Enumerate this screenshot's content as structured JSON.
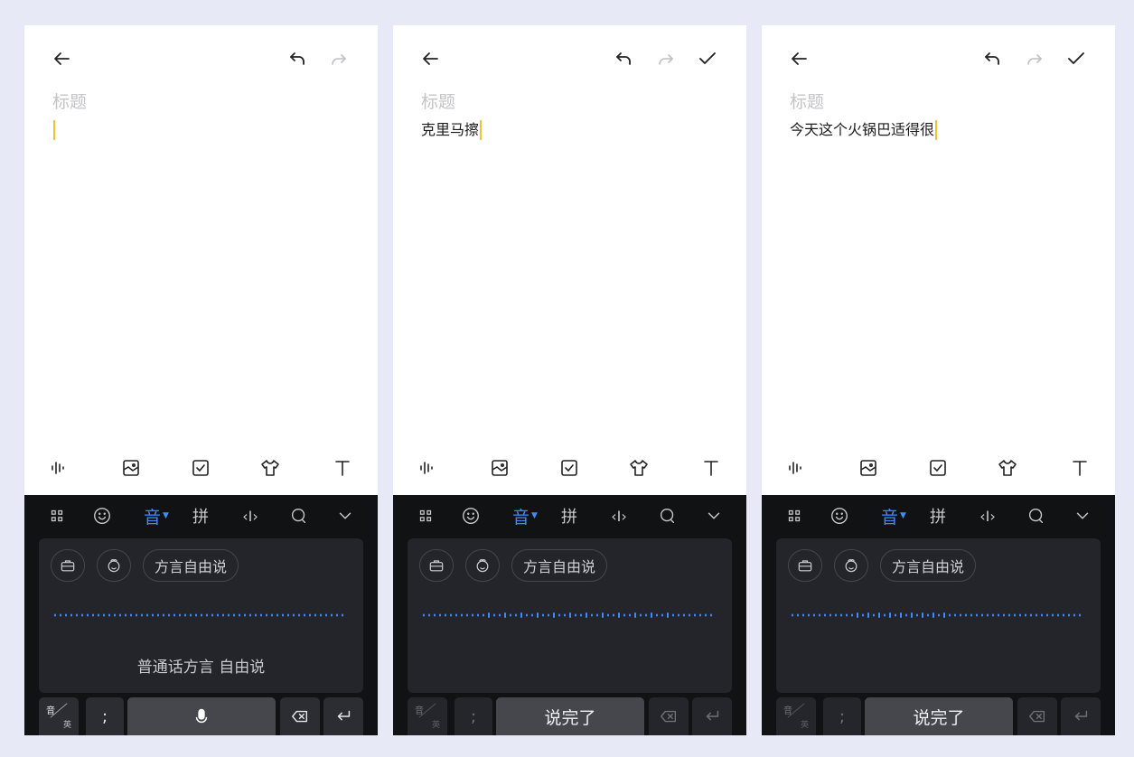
{
  "colors": {
    "background": "#e8e9f6",
    "caret": "#f1c232",
    "accent": "#3e8bff",
    "keyboard_bg": "#111214"
  },
  "screens": [
    {
      "title_placeholder": "标题",
      "content_text": "",
      "toolbar_icons": [
        "back-arrow-icon",
        "undo-icon",
        "redo-icon"
      ],
      "bottom_tools": [
        "voice-wave-icon",
        "image-icon",
        "checkbox-icon",
        "shirt-icon",
        "text-format-icon"
      ],
      "keyboard": {
        "top_row": [
          "apps-grid-icon",
          "emoji-icon",
          "音",
          "拼",
          "‹I›",
          "search-icon",
          "collapse-icon"
        ],
        "chips": [
          "briefcase-icon",
          "emoji-face-icon",
          "方言自由说"
        ],
        "hint": "普通话方言 自由说",
        "mode_key": {
          "top": "音",
          "bottom": "英"
        },
        "punct_key": ";",
        "space_label": "",
        "space_icon": "microphone-icon",
        "delete_icon": "backspace-icon",
        "enter_icon": "enter-icon"
      }
    },
    {
      "title_placeholder": "标题",
      "content_text": "克里马擦",
      "toolbar_icons": [
        "back-arrow-icon",
        "undo-icon",
        "redo-icon",
        "check-icon"
      ],
      "bottom_tools": [
        "voice-wave-icon",
        "image-icon",
        "checkbox-icon",
        "shirt-icon",
        "text-format-icon"
      ],
      "keyboard": {
        "top_row": [
          "apps-grid-icon",
          "emoji-icon",
          "音",
          "拼",
          "‹I›",
          "search-icon",
          "collapse-icon"
        ],
        "chips": [
          "briefcase-icon",
          "emoji-face-icon",
          "方言自由说"
        ],
        "hint": "",
        "mode_key": {
          "top": "音",
          "bottom": "英"
        },
        "punct_key": ";",
        "space_label": "说完了",
        "delete_icon": "backspace-icon",
        "enter_icon": "enter-icon"
      }
    },
    {
      "title_placeholder": "标题",
      "content_text": "今天这个火锅巴适得很",
      "toolbar_icons": [
        "back-arrow-icon",
        "undo-icon",
        "redo-icon",
        "check-icon"
      ],
      "bottom_tools": [
        "voice-wave-icon",
        "image-icon",
        "checkbox-icon",
        "shirt-icon",
        "text-format-icon"
      ],
      "keyboard": {
        "top_row": [
          "apps-grid-icon",
          "emoji-icon",
          "音",
          "拼",
          "‹I›",
          "search-icon",
          "collapse-icon"
        ],
        "chips": [
          "briefcase-icon",
          "emoji-face-icon",
          "方言自由说"
        ],
        "hint": "",
        "mode_key": {
          "top": "音",
          "bottom": "英"
        },
        "punct_key": ";",
        "space_label": "说完了",
        "delete_icon": "backspace-icon",
        "enter_icon": "enter-icon"
      }
    }
  ]
}
